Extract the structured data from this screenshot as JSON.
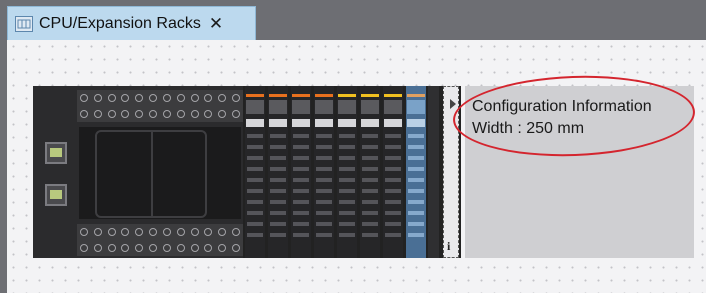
{
  "tab": {
    "title": "CPU/Expansion Racks",
    "close_symbol": "✕",
    "icon": "rack-diagram-icon"
  },
  "config_info": {
    "heading": "Configuration Information",
    "width_text": "Width : 250 mm"
  },
  "rack": {
    "modules": [
      {
        "stripe_color": "#e8701e",
        "blue": false
      },
      {
        "stripe_color": "#e8701e",
        "blue": false
      },
      {
        "stripe_color": "#e8701e",
        "blue": false
      },
      {
        "stripe_color": "#e8701e",
        "blue": false
      },
      {
        "stripe_color": "#f0c020",
        "blue": false
      },
      {
        "stripe_color": "#f0c020",
        "blue": false
      },
      {
        "stripe_color": "#f0c020",
        "blue": false
      },
      {
        "stripe_color": "#e0a060",
        "blue": true
      }
    ],
    "end_plug_label": "i"
  },
  "colors": {
    "annotation_oval": "#d4252e",
    "tab_background": "#bcd9ee"
  }
}
